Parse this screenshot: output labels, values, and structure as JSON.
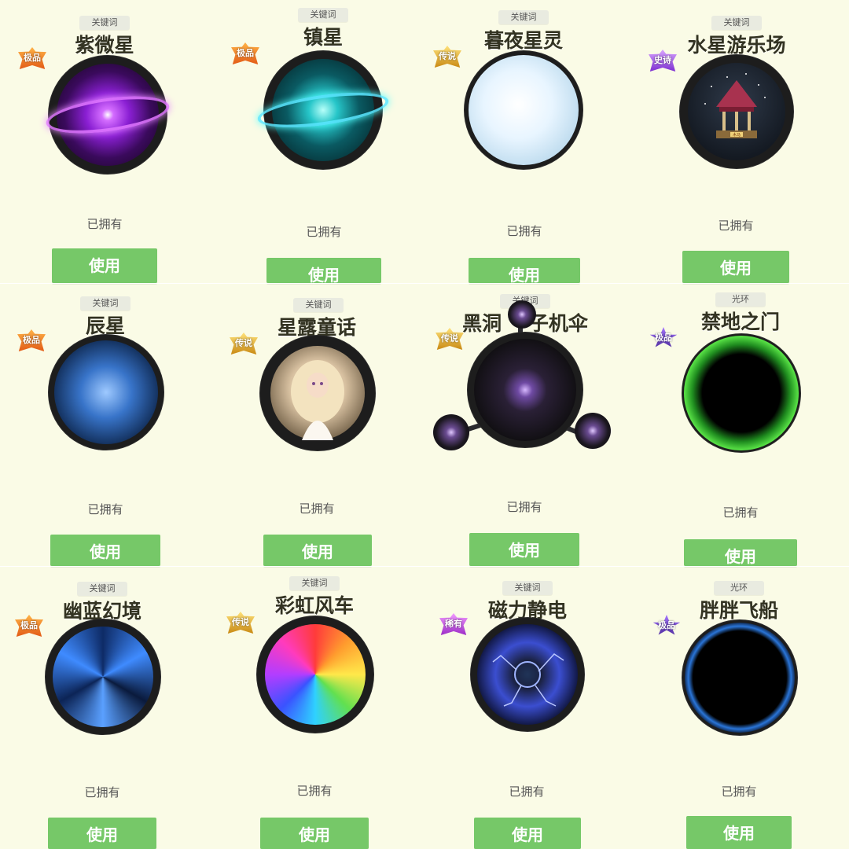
{
  "cards": [
    {
      "tag": "关键词",
      "title": "紫微星",
      "badge": "极品",
      "owned": "已拥有",
      "button": "使用"
    },
    {
      "tag": "关键词",
      "title": "镇星",
      "badge": "极品",
      "owned": "已拥有",
      "button": "使用"
    },
    {
      "tag": "关键词",
      "title": "暮夜星灵",
      "badge": "传说",
      "owned": "已拥有",
      "button": "使用"
    },
    {
      "tag": "关键词",
      "title": "水星游乐场",
      "badge": "史诗",
      "owned": "已拥有",
      "button": "使用"
    },
    {
      "tag": "关键词",
      "title": "辰星",
      "badge": "极品",
      "owned": "已拥有",
      "button": "使用"
    },
    {
      "tag": "关键词",
      "title": "星露童话",
      "badge": "传说",
      "owned": "已拥有",
      "button": "使用"
    },
    {
      "tag": "关键词",
      "title": "黑洞",
      "title_suffix": "子机伞",
      "badge": "传说",
      "owned": "已拥有",
      "button": "使用"
    },
    {
      "tag": "光环",
      "title": "禁地之门",
      "badge": "极品",
      "owned": "已拥有",
      "button": "使用"
    },
    {
      "tag": "关键词",
      "title": "幽蓝幻境",
      "badge": "极品",
      "owned": "已拥有",
      "button": "使用"
    },
    {
      "tag": "关键词",
      "title": "彩虹风车",
      "badge": "传说",
      "owned": "已拥有",
      "button": "使用"
    },
    {
      "tag": "关键词",
      "title": "磁力静电",
      "badge": "稀有",
      "owned": "已拥有",
      "button": "使用"
    },
    {
      "tag": "光环",
      "title": "胖胖飞船",
      "badge": "极品",
      "owned": "已拥有",
      "button": "使用"
    }
  ],
  "carousel_sign": "木马"
}
